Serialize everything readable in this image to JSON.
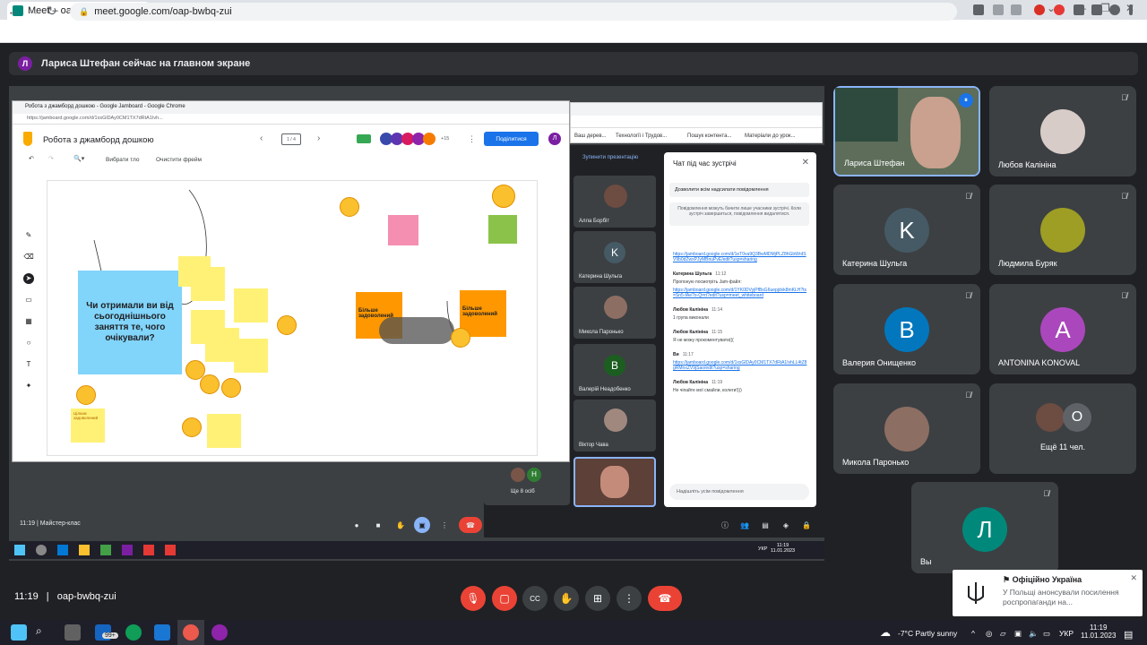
{
  "browser": {
    "tab_title": "Meet – oap-bwbq-zui",
    "url": "meet.google.com/oap-bwbq-zui"
  },
  "banner": {
    "avatar_letter": "Л",
    "text": "Лариса Штефан сейчас на главном экране"
  },
  "shared_screen": {
    "jamboard_window": {
      "title": "Робота з джамборд дошкою - Google Jamboard - Google Chrome",
      "url": "https://jamboard.google.com/d/1xsGlDAy0CM1TX7dRtA1Ivh...",
      "doc_title": "Робота з джамборд дошкою",
      "frame_counter": "1 / 4",
      "collaborators_more": "+15",
      "share_label": "Поділитися",
      "user_letter": "Л",
      "toolbar_select_bg": "Вибрати тло",
      "toolbar_clear": "Очистити фрейм",
      "question_text": "Чи отримали ви від сьогоднішнього заняття те, чого очікували?",
      "sticky_1": "Більше задоволений",
      "sticky_2": "Більше задоволений",
      "sticky_small": "Цілком задоволений"
    },
    "bookmarks": [
      "Ваш дерев...",
      "Технології і Трудов...",
      "Пошук контента...",
      "Матеріали до урок..."
    ],
    "stop_presenting": "Зупинити презентацію",
    "remote_tiles": [
      {
        "name": "Алла Борбіт"
      },
      {
        "name": "Катерина Шульга",
        "letter": "K"
      },
      {
        "name": "Микола Паронько"
      },
      {
        "name": "Валерій Неадобенко",
        "letter": "B"
      },
      {
        "name": "Віктор Чава"
      }
    ],
    "remote_others": "Ще 8 осіб",
    "remote_others_letter": "H",
    "chat": {
      "header": "Чат під час зустрічі",
      "permission": "Дозволити всім надсилати повідомлення",
      "note": "Повідомлення можуть бачити лише учасники зустрічі. Коли зустріч завершиться, повідомлення видалятися.",
      "messages": [
        {
          "link": "https://jamboard.google.com/d/1eT0va9Q3BwMDMjPLZ8hGbWrdSV9b0dZwxPJyMBnuPvE/edit?usp=sharing"
        },
        {
          "author": "Катерина Шульга",
          "time": "11:12",
          "text": "Пропоную посмотріть Jam-файл:",
          "link": "https://jamboard.google.com/d/1YK0DVyjPfBsG6uepjdvk8mKLH?ts=Sn5-fAe?o-Q=rt?edit?usp=meet_whiteboard"
        },
        {
          "author": "Любов Калініна",
          "time": "11:14",
          "text": "1 група виконали"
        },
        {
          "author": "Любов Калініна",
          "time": "11:15",
          "text": "Я не можу прокоментувати((("
        },
        {
          "author": "Ви",
          "time": "11:17",
          "link": "https://jamboard.google.com/d/1xsGlDAy0CM1TX7dRtA1IvhLL4tZ8gRMnxZV9jSao/edit?usp=sharing"
        },
        {
          "author": "Любов Калініна",
          "time": "11:19",
          "text": "Не чіпайте мої смайли, колеги!)))"
        }
      ],
      "input_placeholder": "Надішліть усім повідомлення"
    },
    "remote_time": "11:19",
    "remote_meeting": "Майстер-клас",
    "remote_clock": "11:19",
    "remote_date": "11.01.2023",
    "remote_lang": "УКР"
  },
  "tiles": [
    {
      "name": "Лариса Штефан",
      "type": "photo"
    },
    {
      "name": "Любов Калініна",
      "type": "photo"
    },
    {
      "name": "Катерина Шульга",
      "letter": "K",
      "color": "#455a64"
    },
    {
      "name": "Людмила Буряк",
      "type": "photo"
    },
    {
      "name": "Валерия Онищенко",
      "letter": "B",
      "color": "#0277bd"
    },
    {
      "name": "ANTONINA KONOVAL",
      "letter": "A",
      "color": "#ab47bc"
    },
    {
      "name": "Микола Паронько",
      "type": "photo"
    },
    {
      "name": "Ещё 11 чел.",
      "letter": "O",
      "color": "#5f6368"
    },
    {
      "name": "Вы",
      "letter": "Л",
      "color": "#00897b"
    }
  ],
  "bottom": {
    "time": "11:19",
    "separator": "|",
    "meeting_code": "oap-bwbq-zui"
  },
  "notification": {
    "title": "Офіційно Україна",
    "body": "У Польщі анонсували посилення роспропаганди на..."
  },
  "taskbar": {
    "badge": "99+",
    "weather": "-7°C  Partly sunny",
    "lang": "УКР",
    "clock": "11:19",
    "date": "11.01.2023"
  },
  "colors": {
    "accent_blue": "#1a73e8",
    "end_call_red": "#ea4335",
    "meet_bg": "#202124",
    "tile_bg": "#3c4043"
  }
}
